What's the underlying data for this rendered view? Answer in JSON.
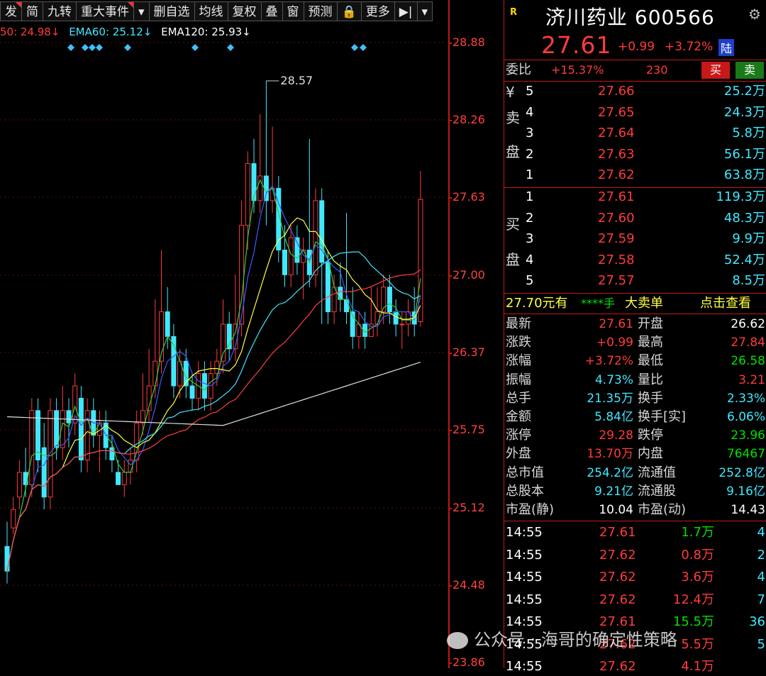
{
  "toolbar": {
    "items": [
      "发",
      "简",
      "九转",
      "重大事件",
      "▾",
      "删自选",
      "均线",
      "复权",
      "叠",
      "窗",
      "预测",
      "🔒",
      "更多",
      "▶|",
      "▾"
    ]
  },
  "ema": {
    "ema50": "50: 24.98↓",
    "ema60": "EMA60: 25.12↓",
    "ema120": "EMA120: 25.93↓"
  },
  "price_axis": [
    "28.88",
    "28.26",
    "27.63",
    "27.00",
    "26.37",
    "25.75",
    "25.12",
    "24.48",
    "23.86"
  ],
  "high_marker": "28.57",
  "stock": {
    "name": "济川药业 600566",
    "r_icon": "R",
    "price": "27.61",
    "change": "+0.99",
    "change_pct": "+3.72%",
    "lu_badge": "陆"
  },
  "weibi": {
    "label": "委比",
    "pct": "+15.37%",
    "diff": "230",
    "buy_label": "买",
    "sell_label": "卖"
  },
  "sell_side": {
    "label_chars": [
      "¥",
      "卖",
      "盘"
    ],
    "rows": [
      {
        "level": "5",
        "price": "27.66",
        "vol": "25.2万"
      },
      {
        "level": "4",
        "price": "27.65",
        "vol": "24.3万"
      },
      {
        "level": "3",
        "price": "27.64",
        "vol": "5.8万"
      },
      {
        "level": "2",
        "price": "27.63",
        "vol": "56.1万"
      },
      {
        "level": "1",
        "price": "27.62",
        "vol": "63.8万"
      }
    ]
  },
  "buy_side": {
    "label_chars": [
      "买",
      "盘"
    ],
    "rows": [
      {
        "level": "1",
        "price": "27.61",
        "vol": "119.3万"
      },
      {
        "level": "2",
        "price": "27.60",
        "vol": "48.3万"
      },
      {
        "level": "3",
        "price": "27.59",
        "vol": "9.9万"
      },
      {
        "level": "4",
        "price": "27.58",
        "vol": "52.4万"
      },
      {
        "level": "5",
        "price": "27.57",
        "vol": "8.5万"
      }
    ]
  },
  "big_order": {
    "price": "27.70元有",
    "qty": "****手",
    "label": "大卖单",
    "link": "点击查看"
  },
  "stats": [
    {
      "l1": "最新",
      "v1": "27.61",
      "c1": "red",
      "l2": "开盘",
      "v2": "26.62",
      "c2": "white"
    },
    {
      "l1": "涨跌",
      "v1": "+0.99",
      "c1": "red",
      "l2": "最高",
      "v2": "27.84",
      "c2": "red"
    },
    {
      "l1": "涨幅",
      "v1": "+3.72%",
      "c1": "red",
      "l2": "最低",
      "v2": "26.58",
      "c2": "green"
    },
    {
      "l1": "振幅",
      "v1": "4.73%",
      "c1": "cyan",
      "l2": "量比",
      "v2": "3.21",
      "c2": "red"
    },
    {
      "l1": "总手",
      "v1": "21.35万",
      "c1": "cyan",
      "l2": "换手",
      "v2": "2.33%",
      "c2": "cyan"
    },
    {
      "l1": "金额",
      "v1": "5.84亿",
      "c1": "cyan",
      "l2": "换手[实]",
      "v2": "6.06%",
      "c2": "cyan"
    },
    {
      "l1": "涨停",
      "v1": "29.28",
      "c1": "red",
      "l2": "跌停",
      "v2": "23.96",
      "c2": "green"
    },
    {
      "l1": "外盘",
      "v1": "13.70万",
      "c1": "red",
      "l2": "内盘",
      "v2": "76467",
      "c2": "green"
    },
    {
      "l1": "总市值",
      "v1": "254.2亿",
      "c1": "cyan",
      "l2": "流通值",
      "v2": "252.8亿",
      "c2": "cyan"
    },
    {
      "l1": "总股本",
      "v1": "9.21亿",
      "c1": "cyan",
      "l2": "流通股",
      "v2": "9.16亿",
      "c2": "cyan"
    },
    {
      "l1": "市盈(静)",
      "v1": "10.04",
      "c1": "white",
      "l2": "市盈(动)",
      "v2": "14.43",
      "c2": "white"
    }
  ],
  "ticks": [
    {
      "time": "14:55",
      "price": "27.61",
      "vol": "1.7万",
      "vc": "green",
      "n": "4"
    },
    {
      "time": "14:55",
      "price": "27.62",
      "vol": "0.8万",
      "vc": "red",
      "n": "2"
    },
    {
      "time": "14:55",
      "price": "27.62",
      "vol": "3.6万",
      "vc": "red",
      "n": "4"
    },
    {
      "time": "14:55",
      "price": "27.62",
      "vol": "12.4万",
      "vc": "red",
      "n": "7"
    },
    {
      "time": "14:55",
      "price": "27.61",
      "vol": "15.5万",
      "vc": "green",
      "n": "36"
    },
    {
      "time": "14:55",
      "price": "27.62",
      "vol": "5.5万",
      "vc": "red",
      "n": "5"
    },
    {
      "time": "14:55",
      "price": "27.62",
      "vol": "4.1万",
      "vc": "red",
      "n": ""
    }
  ],
  "watermark": "公众号 · 海哥的确定性策略",
  "colors": {
    "up": "#ff3b3b",
    "down": "#40e8ff",
    "grid": "#c01818",
    "bg": "#000000"
  }
}
